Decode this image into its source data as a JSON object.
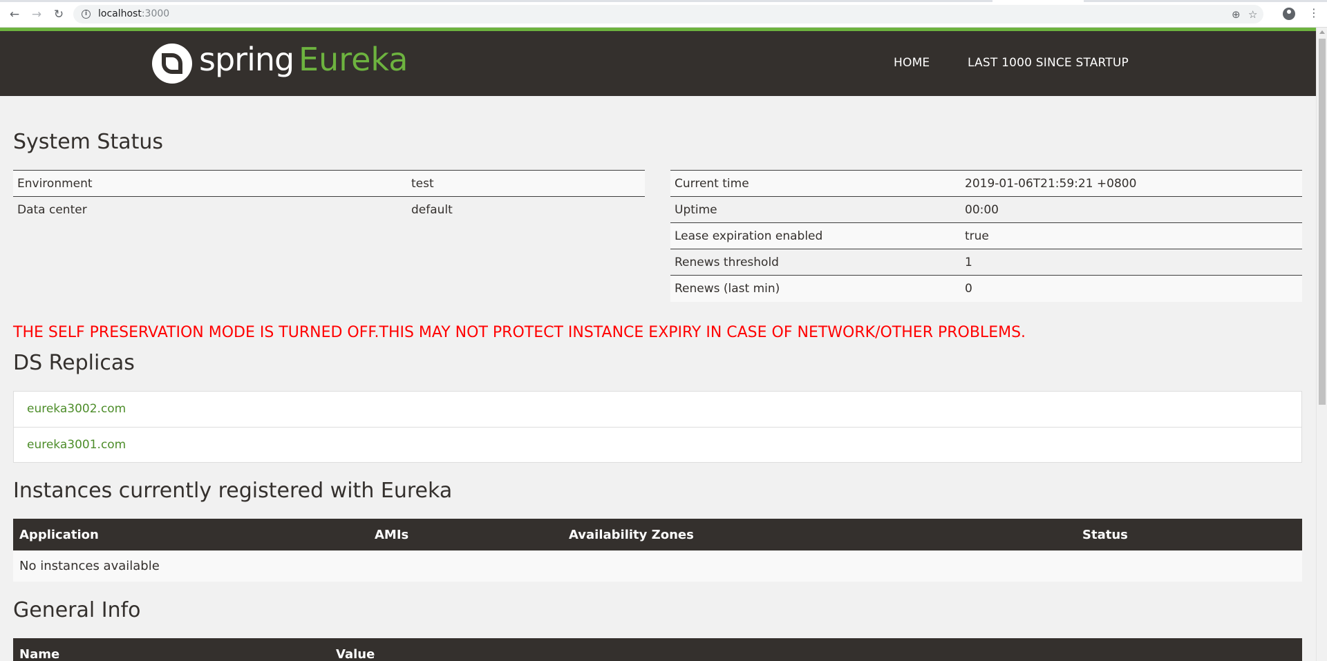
{
  "browser": {
    "url_host": "localhost",
    "url_port": ":3000"
  },
  "header": {
    "logo_spring": "spring",
    "logo_eureka": "Eureka",
    "nav": [
      {
        "label": "HOME"
      },
      {
        "label": "LAST 1000 SINCE STARTUP"
      }
    ]
  },
  "system_status": {
    "title": "System Status",
    "left": [
      {
        "label": "Environment",
        "value": "test"
      },
      {
        "label": "Data center",
        "value": "default"
      }
    ],
    "right": [
      {
        "label": "Current time",
        "value": "2019-01-06T21:59:21 +0800"
      },
      {
        "label": "Uptime",
        "value": "00:00"
      },
      {
        "label": "Lease expiration enabled",
        "value": "true"
      },
      {
        "label": "Renews threshold",
        "value": "1"
      },
      {
        "label": "Renews (last min)",
        "value": "0"
      }
    ]
  },
  "warning": "THE SELF PRESERVATION MODE IS TURNED OFF.THIS MAY NOT PROTECT INSTANCE EXPIRY IN CASE OF NETWORK/OTHER PROBLEMS.",
  "replicas": {
    "title": "DS Replicas",
    "items": [
      "eureka3002.com",
      "eureka3001.com"
    ]
  },
  "instances": {
    "title": "Instances currently registered with Eureka",
    "columns": [
      "Application",
      "AMIs",
      "Availability Zones",
      "Status"
    ],
    "empty_text": "No instances available"
  },
  "general_info": {
    "title": "General Info",
    "columns": [
      "Name",
      "Value"
    ]
  },
  "colors": {
    "brand_green": "#6db33f",
    "header_dark": "#34302d",
    "warning_red": "#ff0000",
    "link_green": "#4d8d2a"
  }
}
